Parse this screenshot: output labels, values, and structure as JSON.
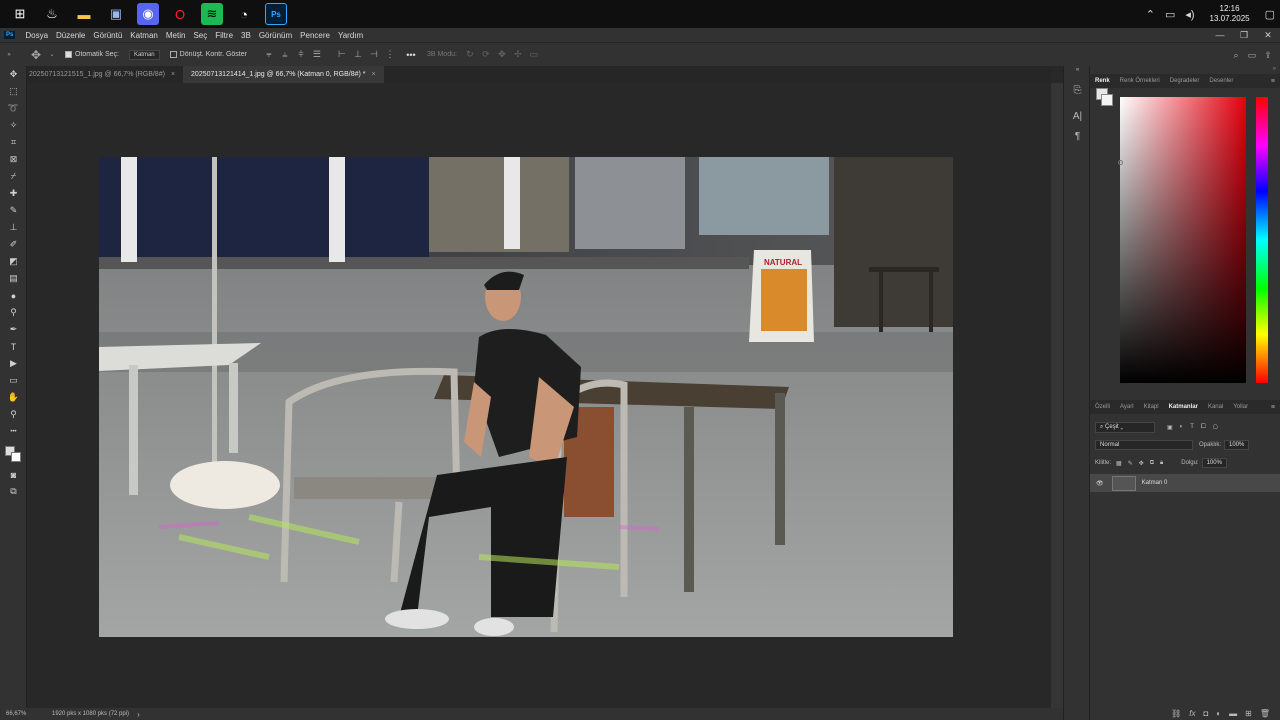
{
  "taskbar": {
    "apps": [
      {
        "name": "windows-start-icon",
        "glyph": "⊞",
        "color": "#ffffff",
        "bg": ""
      },
      {
        "name": "steam-icon",
        "glyph": "♨",
        "color": "#ffffff",
        "bg": ""
      },
      {
        "name": "file-explorer-icon",
        "glyph": "▬",
        "color": "#f4c542",
        "bg": ""
      },
      {
        "name": "control-panel-icon",
        "glyph": "▣",
        "color": "#9ab8f0",
        "bg": ""
      },
      {
        "name": "discord-icon",
        "glyph": "◉",
        "color": "#ffffff",
        "bg": "#5865f2"
      },
      {
        "name": "opera-icon",
        "glyph": "O",
        "color": "#ff1b2d",
        "bg": ""
      },
      {
        "name": "spotify-icon",
        "glyph": "≋",
        "color": "#000000",
        "bg": "#1db954"
      },
      {
        "name": "recorder-icon",
        "glyph": "◔",
        "color": "#ffffff",
        "bg": ""
      },
      {
        "name": "photoshop-taskbar-icon",
        "glyph": "Ps",
        "color": "#31a8ff",
        "bg": "#001e36"
      }
    ],
    "sys_icons": [
      "chevron-up-icon",
      "network-icon",
      "speaker-icon"
    ],
    "time": "12:16",
    "date": "13.07.2025"
  },
  "menubar": {
    "logo": "Ps",
    "items": [
      "Dosya",
      "Düzenle",
      "Görüntü",
      "Katman",
      "Metin",
      "Seç",
      "Filtre",
      "3B",
      "Görünüm",
      "Pencere",
      "Yardım"
    ]
  },
  "options": {
    "auto_select_label": "Otomatik Seç:",
    "auto_select_value": "Katman",
    "transform_label": "Dönüşt. Kontr. Göster",
    "mode3d_label": "3B Modu:"
  },
  "tabs": [
    {
      "label": "20250713121515_1.jpg @ 66,7% (RGB/8#)",
      "active": false
    },
    {
      "label": "20250713121414_1.jpg @ 66,7% (Katman 0, RGB/8#) *",
      "active": true
    }
  ],
  "photo": {
    "sign_text": "NATURAL"
  },
  "status": {
    "zoom": "66,67%",
    "doc_info": "1920 pks x 1080 pks (72 ppi)"
  },
  "color_panel": {
    "tabs": [
      "Renk",
      "Renk Örnekleri",
      "Degradeler",
      "Desenler"
    ],
    "fg_color": "#e6e6e6",
    "bg_color": "#f4f4f4"
  },
  "layers_panel": {
    "tabs": [
      "Özelli",
      "Ayarl",
      "Kitapl",
      "Katmanlar",
      "Kanal",
      "Yollar"
    ],
    "filter": "Çeşit",
    "blend_mode": "Normal",
    "opacity_label": "Opaklık:",
    "opacity": "100%",
    "lock_label": "Kilitle:",
    "fill_label": "Dolgu:",
    "fill": "100%",
    "layer_name": "Katman 0"
  }
}
